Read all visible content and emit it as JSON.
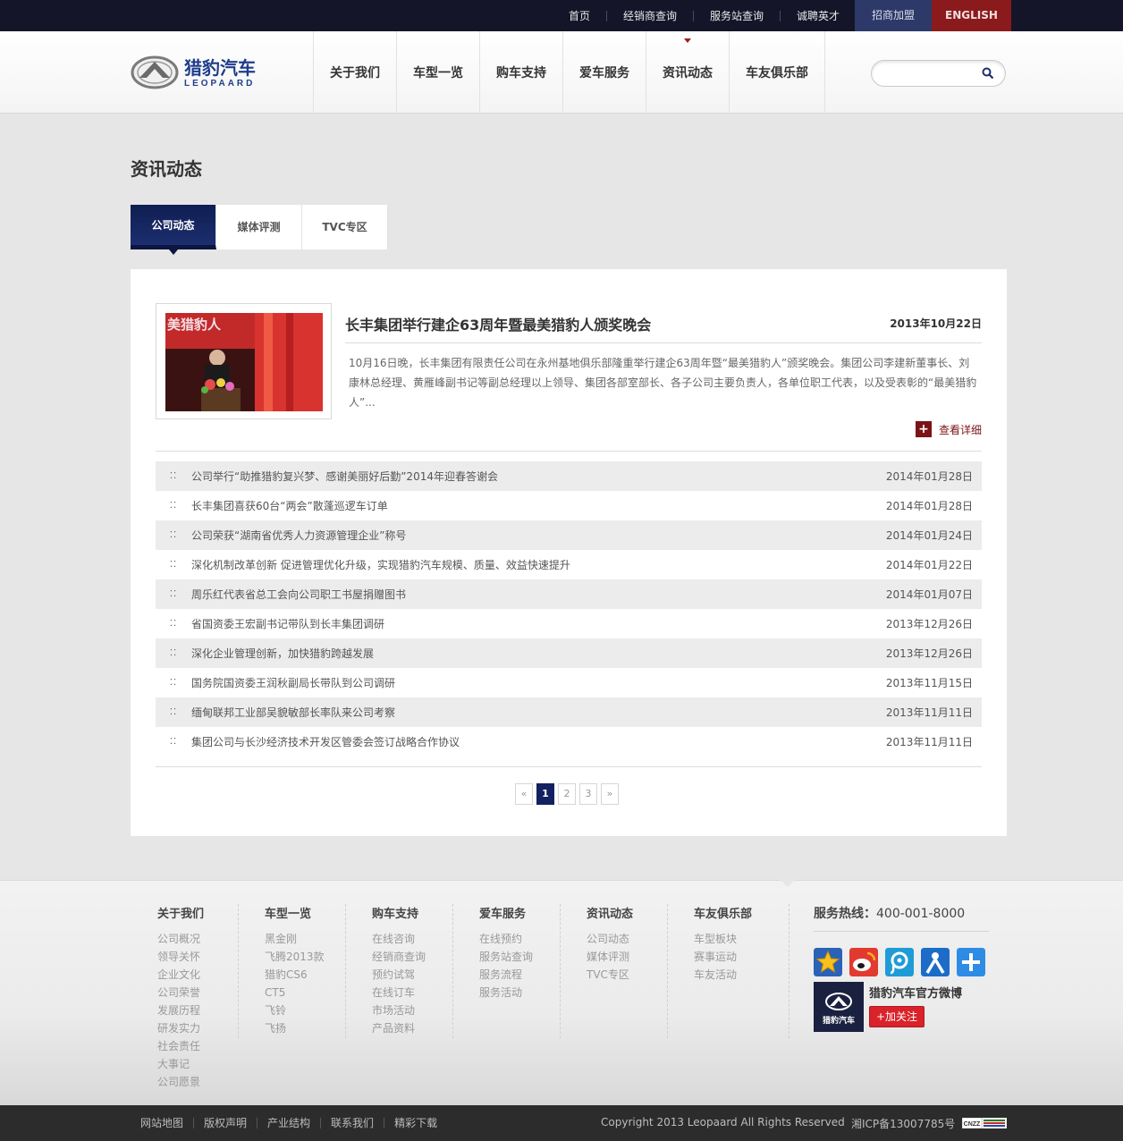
{
  "topbar": {
    "links": [
      "首页",
      "经销商查询",
      "服务站查询",
      "诚聘英才"
    ],
    "join": "招商加盟",
    "english": "ENGLISH"
  },
  "header": {
    "logo_cn": "猎豹汽车",
    "logo_en": "LEOPAARD",
    "nav": [
      "关于我们",
      "车型一览",
      "购车支持",
      "爱车服务",
      "资讯动态",
      "车友俱乐部"
    ],
    "active_nav": "资讯动态",
    "search": {
      "value": "",
      "placeholder": ""
    }
  },
  "page": {
    "title": "资讯动态",
    "tabs": [
      "公司动态",
      "媒体评测",
      "TVC专区"
    ],
    "active_tab": "公司动态"
  },
  "featured": {
    "title": "长丰集团举行建企63周年暨最美猎豹人颁奖晚会",
    "date": "2013年10月22日",
    "summary": "10月16日晚，长丰集团有限责任公司在永州基地俱乐部隆重举行建企63周年暨“最美猎豹人”颁奖晚会。集团公司李建新董事长、刘康林总经理、黄雁峰副书记等副总经理以上领导、集团各部室部长、各子公司主要负责人，各单位职工代表，以及受表彰的“最美猎豹人”...",
    "more": "查看详细",
    "thumb_text": "美猎豹人"
  },
  "news": [
    {
      "title": "公司举行“助推猎豹复兴梦、感谢美丽好后勤”2014年迎春答谢会",
      "date": "2014年01月28日"
    },
    {
      "title": "长丰集团喜获60台“两会”散蓬巡逻车订单",
      "date": "2014年01月28日"
    },
    {
      "title": "公司荣获“湖南省优秀人力资源管理企业”称号",
      "date": "2014年01月24日"
    },
    {
      "title": "深化机制改革创新 促进管理优化升级，实现猎豹汽车规模、质量、效益快速提升",
      "date": "2014年01月22日"
    },
    {
      "title": "周乐红代表省总工会向公司职工书屋捐赠图书",
      "date": "2014年01月07日"
    },
    {
      "title": "省国资委王宏副书记带队到长丰集团调研",
      "date": "2013年12月26日"
    },
    {
      "title": "深化企业管理创新，加快猎豹跨越发展",
      "date": "2013年12月26日"
    },
    {
      "title": "国务院国资委王润秋副局长带队到公司调研",
      "date": "2013年11月15日"
    },
    {
      "title": "缅甸联邦工业部吴貌敏部长率队来公司考察",
      "date": "2013年11月11日"
    },
    {
      "title": "集团公司与长沙经济技术开发区管委会签订战略合作协议",
      "date": "2013年11月11日"
    }
  ],
  "pager": {
    "prev": "«",
    "pages": [
      "1",
      "2",
      "3"
    ],
    "current": "1",
    "next": "»"
  },
  "footer": {
    "columns": [
      {
        "title": "关于我们",
        "links": [
          "公司概况",
          "领导关怀",
          "企业文化",
          "公司荣誉",
          "发展历程",
          "研发实力",
          "社会责任",
          "大事记",
          "公司愿景"
        ]
      },
      {
        "title": "车型一览",
        "links": [
          "黑金刚",
          "飞腾2013款",
          "猎豹CS6",
          "CT5",
          "飞铃",
          "飞扬"
        ]
      },
      {
        "title": "购车支持",
        "links": [
          "在线咨询",
          "经销商查询",
          "预约试驾",
          "在线订车",
          "市场活动",
          "产品资料"
        ]
      },
      {
        "title": "爱车服务",
        "links": [
          "在线预约",
          "服务站查询",
          "服务流程",
          "服务活动"
        ]
      },
      {
        "title": "资讯动态",
        "links": [
          "公司动态",
          "媒体评测",
          "TVC专区"
        ]
      },
      {
        "title": "车友俱乐部",
        "links": [
          "车型板块",
          "赛事运动",
          "车友活动"
        ]
      }
    ],
    "hotline_label": "服务热线：",
    "hotline": "400-001-8000",
    "share_icons": [
      "favorite-star-icon",
      "sina-weibo-icon",
      "tencent-weibo-icon",
      "renren-icon",
      "share-plus-icon"
    ],
    "weibo_name": "猎豹汽车官方微博",
    "weibo_logo_text": "猎豹汽车",
    "follow": "+加关注"
  },
  "bottom": {
    "links": [
      "网站地图",
      "版权声明",
      "产业结构",
      "联系我们",
      "精彩下载"
    ],
    "copyright": "Copyright 2013 Leopaard All Rights Reserved",
    "icp": "湘ICP备13007785号",
    "cnzz": "CNZZ"
  },
  "colors": {
    "topbar": "#15152a",
    "join": "#2d3a69",
    "english": "#8a1a1c",
    "active_tab": "#132160",
    "accent_red": "#7a1416"
  }
}
